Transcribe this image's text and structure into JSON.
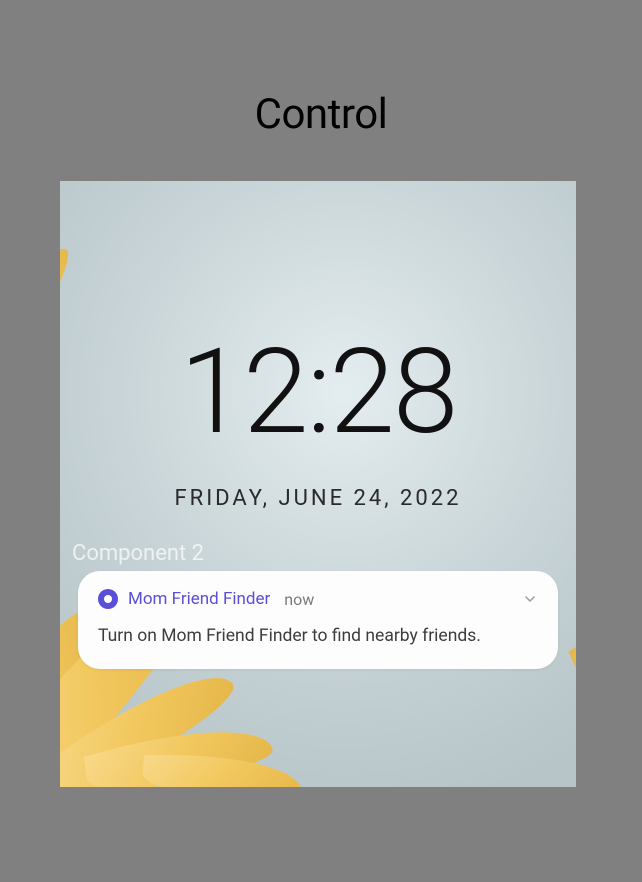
{
  "page": {
    "title": "Control",
    "component_label": "Component 2"
  },
  "lockscreen": {
    "time": "12:28",
    "date": "FRIDAY, JUNE 24, 2022"
  },
  "notification": {
    "app_name": "Mom Friend Finder",
    "timestamp": "now",
    "message": "Turn on Mom Friend Finder to find nearby friends.",
    "icon_name": "circle-dot-icon",
    "accent_color": "#5b4fd8"
  }
}
